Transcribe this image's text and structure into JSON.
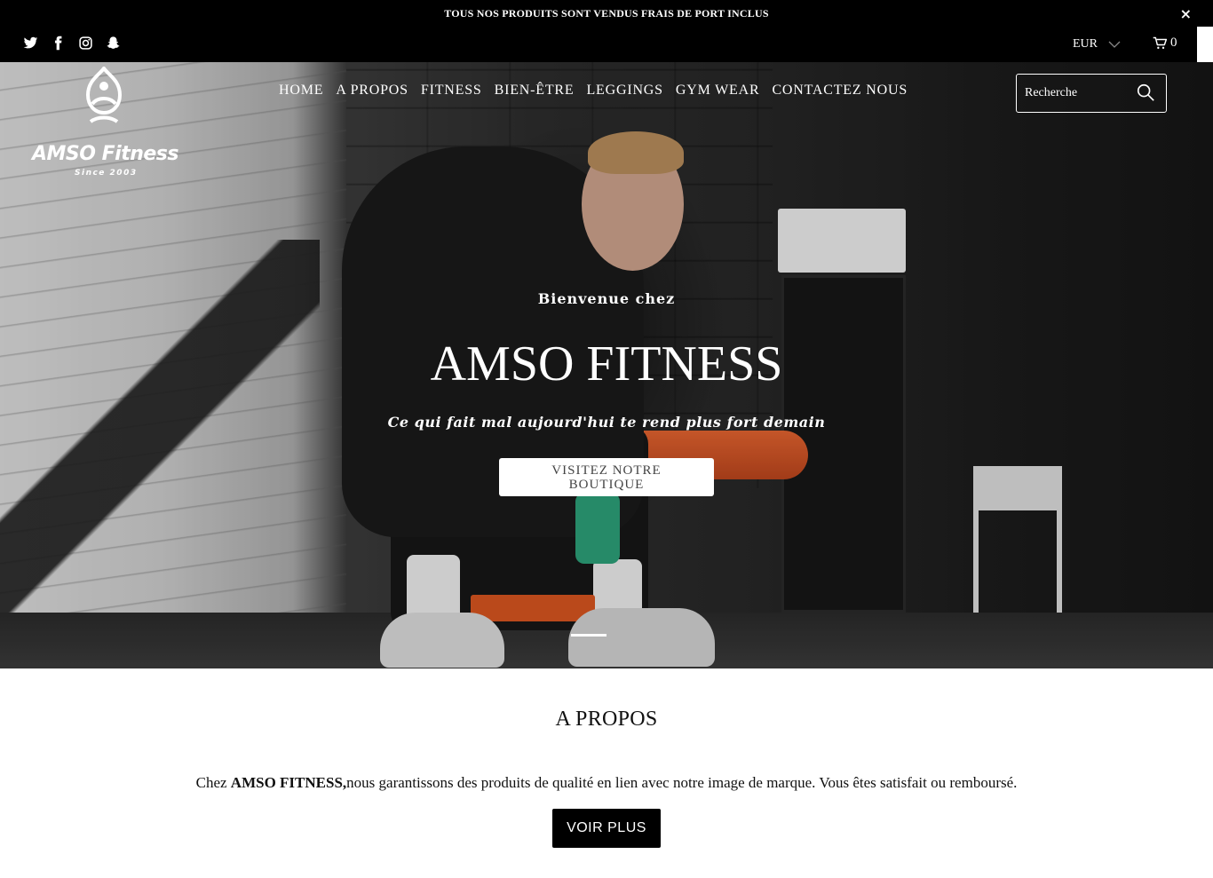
{
  "announcement": {
    "text": "TOUS NOS PRODUITS SONT VENDUS FRAIS DE PORT INCLUS",
    "close_label": "×"
  },
  "social": [
    "twitter-icon",
    "facebook-icon",
    "instagram-icon",
    "snapchat-icon"
  ],
  "header": {
    "currency": "EUR",
    "cart_count": "0"
  },
  "logo": {
    "brand": "AMSO Fitness",
    "since": "Since 2003"
  },
  "nav": {
    "items": [
      {
        "label": "HOME"
      },
      {
        "label": "A PROPOS"
      },
      {
        "label": "FITNESS"
      },
      {
        "label": "BIEN-ÊTRE"
      },
      {
        "label": "LEGGINGS"
      },
      {
        "label": "GYM WEAR"
      },
      {
        "label": "CONTACTEZ NOUS"
      }
    ]
  },
  "search": {
    "placeholder": "Recherche",
    "value": ""
  },
  "hero": {
    "pretitle": "Bienvenue chez",
    "title": "AMSO FITNESS",
    "tagline": "Ce qui fait mal aujourd'hui te rend plus fort demain",
    "button_label": "VISITEZ NOTRE BOUTIQUE"
  },
  "about": {
    "title": "A PROPOS",
    "text_prefix": "Chez ",
    "text_brand": "AMSO FITNESS,",
    "text_suffix": "nous garantissons des produits de qualité en lien avec notre image de marque. Vous êtes satisfait ou remboursé.",
    "button_label": "VOIR PLUS"
  },
  "colors": {
    "topbar": "#000000",
    "accent": "#ffffff",
    "text": "#111111"
  }
}
